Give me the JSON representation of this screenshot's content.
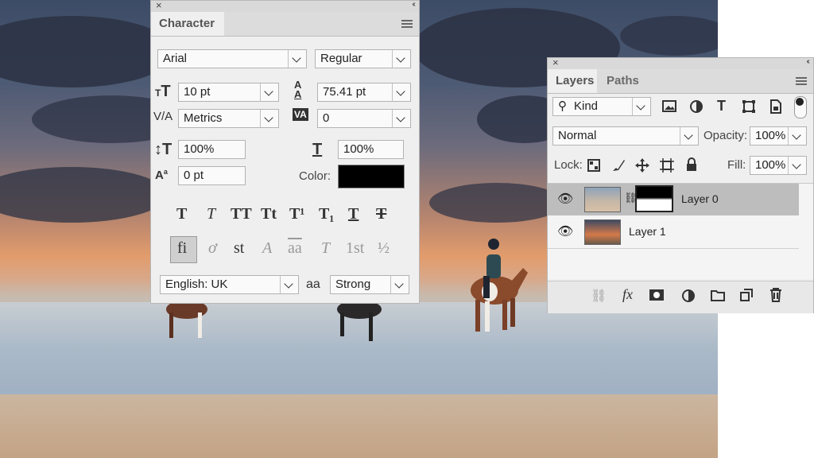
{
  "character_panel": {
    "tab": "Character",
    "font_family": "Arial",
    "font_style": "Regular",
    "font_size": "10 pt",
    "leading": "75.41 pt",
    "kerning": "Metrics",
    "tracking": "0",
    "vertical_scale": "100%",
    "horizontal_scale": "100%",
    "baseline_shift": "0 pt",
    "color_label": "Color:",
    "color_value": "#000000",
    "type_buttons": [
      "T",
      "T",
      "TT",
      "Tt",
      "T¹",
      "T₁",
      "T",
      "T"
    ],
    "opentype_buttons": [
      "fi",
      "ơ",
      "st",
      "A",
      "aa",
      "T",
      "1st",
      "½"
    ],
    "language": "English: UK",
    "antialias_glyph": "aa",
    "antialias": "Strong"
  },
  "layers_panel": {
    "tabs": [
      "Layers",
      "Paths"
    ],
    "filter_kind": "Kind",
    "blend_mode": "Normal",
    "opacity_label": "Opacity:",
    "opacity": "100%",
    "lock_label": "Lock:",
    "fill_label": "Fill:",
    "fill": "100%",
    "layers": [
      {
        "name": "Layer 0",
        "selected": true,
        "has_mask": true
      },
      {
        "name": "Layer 1",
        "selected": false,
        "has_mask": false
      }
    ],
    "footer_icons": [
      "link-icon",
      "fx-icon",
      "mask-icon",
      "adjustment-icon",
      "folder-icon",
      "new-layer-icon",
      "trash-icon"
    ],
    "footer_fx": "fx"
  }
}
